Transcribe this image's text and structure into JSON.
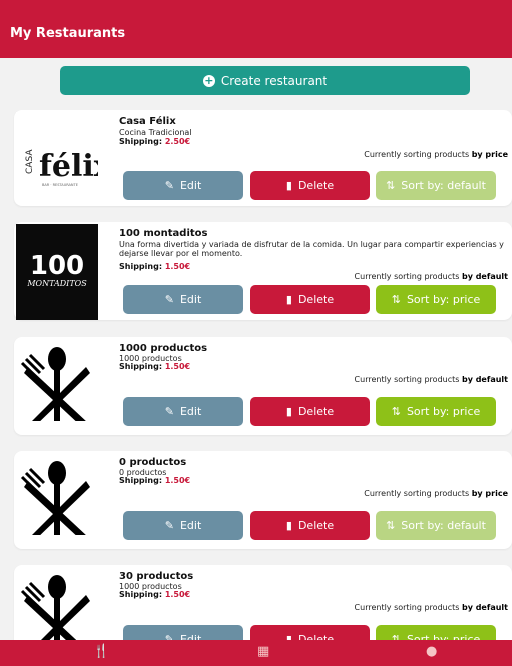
{
  "header": {
    "title": "My Restaurants"
  },
  "create": {
    "label": "Create restaurant"
  },
  "sorting_prefix": "Currently sorting products",
  "buttons": {
    "edit": "Edit",
    "delete": "Delete"
  },
  "shipping_label": "Shipping:",
  "restaurants": [
    {
      "name": "Casa Félix",
      "description": "Cocina Tradicional",
      "shipping": "2.50€",
      "sort_by": "by price",
      "sort_button": "Sort by: default",
      "sort_enabled": false,
      "logo": "casa-felix-logo"
    },
    {
      "name": "100 montaditos",
      "description": "Una forma divertida y variada de disfrutar de la comida. Un lugar para compartir experiencias y dejarse llevar por el momento.",
      "shipping": "1.50€",
      "sort_by": "by default",
      "sort_button": "Sort by: price",
      "sort_enabled": true,
      "logo": "100-montaditos-logo",
      "logo_text": [
        "100",
        "MONTADITOS"
      ]
    },
    {
      "name": "1000 productos",
      "description": "1000 productos",
      "shipping": "1.50€",
      "sort_by": "by default",
      "sort_button": "Sort by: price",
      "sort_enabled": true,
      "logo": "fork-knife-spoon-logo"
    },
    {
      "name": "0 productos",
      "description": "0 productos",
      "shipping": "1.50€",
      "sort_by": "by price",
      "sort_button": "Sort by: default",
      "sort_enabled": false,
      "logo": "fork-knife-spoon-logo"
    },
    {
      "name": "30 productos",
      "description": "1000 productos",
      "shipping": "1.50€",
      "sort_by": "by default",
      "sort_button": "Sort by: price",
      "sort_enabled": true,
      "logo": "fork-knife-spoon-logo"
    }
  ],
  "tabbar": {
    "items": [
      {
        "icon": "restaurant-icon",
        "active": true
      },
      {
        "icon": "dashboard-icon",
        "active": false
      },
      {
        "icon": "profile-icon",
        "active": false
      }
    ]
  },
  "colors": {
    "primary": "#c8193a",
    "teal": "#1e9b8c",
    "edit": "#6a8fa3",
    "sort_active": "#8ec118",
    "sort_disabled": "#b9d583",
    "active_tab": "#f6c21b"
  }
}
